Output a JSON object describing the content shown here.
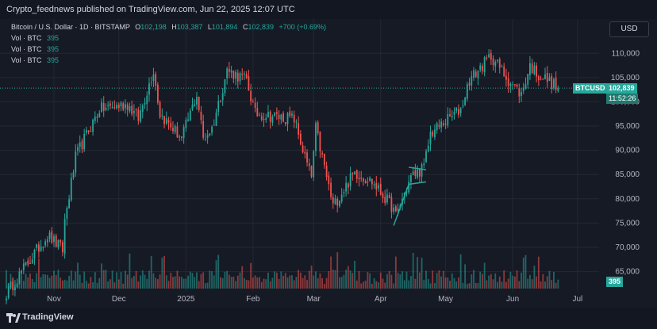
{
  "header": {
    "publisher": "Crypto_feednews published on TradingView.com, Jun 22, 2025 12:07 UTC"
  },
  "legend": {
    "title": "Bitcoin / U.S. Dollar · 1D · BITSTAMP",
    "o_label": "O",
    "o_val": "102,198",
    "h_label": "H",
    "h_val": "103,387",
    "l_label": "L",
    "l_val": "101,894",
    "c_label": "C",
    "c_val": "102,839",
    "change": "+700 (+0.69%)",
    "vol_lines": [
      {
        "label": "Vol · BTC",
        "value": "395"
      },
      {
        "label": "Vol · BTC",
        "value": "395"
      },
      {
        "label": "Vol · BTC",
        "value": "395"
      }
    ]
  },
  "currency_button": "USD",
  "price_tag": {
    "symbol": "BTCUSD",
    "price": "102,839",
    "countdown": "11:52:26"
  },
  "volume_tag": "395",
  "footer": {
    "brand": "TradingView"
  },
  "colors": {
    "up": "#26a69a",
    "down": "#ef5350",
    "background": "#131722",
    "grid": "#242833"
  },
  "chart_data": {
    "type": "candlestick",
    "title": "Bitcoin / U.S. Dollar · 1D · BITSTAMP",
    "y_ticks": [
      110000,
      105000,
      100000,
      95000,
      90000,
      85000,
      80000,
      75000,
      70000,
      65000
    ],
    "y_tick_labels": [
      "110,000",
      "105,000",
      "100,000",
      "95,000",
      "90,000",
      "85,000",
      "80,000",
      "75,000",
      "70,000",
      "65,000"
    ],
    "ylim": [
      61500,
      113800
    ],
    "x_tick_labels": [
      "Nov",
      "Dec",
      "2025",
      "Feb",
      "Mar",
      "Apr",
      "May",
      "Jun",
      "Jul"
    ],
    "x_tick_dates": [
      "2024-11-01",
      "2024-12-01",
      "2025-01-01",
      "2025-02-01",
      "2025-03-01",
      "2025-04-01",
      "2025-05-01",
      "2025-06-01",
      "2025-07-01"
    ],
    "start_date": "2024-10-10",
    "end_date": "2025-06-22",
    "anchor_closes": [
      [
        "2024-10-10",
        60500
      ],
      [
        "2024-10-21",
        67500
      ],
      [
        "2024-10-29",
        72500
      ],
      [
        "2024-11-05",
        69500
      ],
      [
        "2024-11-06",
        75500
      ],
      [
        "2024-11-11",
        88500
      ],
      [
        "2024-11-13",
        90500
      ],
      [
        "2024-11-22",
        98500
      ],
      [
        "2024-12-05",
        99500
      ],
      [
        "2024-12-10",
        96500
      ],
      [
        "2024-12-17",
        106500
      ],
      [
        "2024-12-20",
        97500
      ],
      [
        "2024-12-30",
        92500
      ],
      [
        "2025-01-06",
        101500
      ],
      [
        "2025-01-09",
        92500
      ],
      [
        "2025-01-13",
        94500
      ],
      [
        "2025-01-20",
        106500
      ],
      [
        "2025-01-29",
        104500
      ],
      [
        "2025-02-02",
        97500
      ],
      [
        "2025-02-20",
        96500
      ],
      [
        "2025-02-25",
        88500
      ],
      [
        "2025-02-28",
        84500
      ],
      [
        "2025-03-02",
        94500
      ],
      [
        "2025-03-10",
        78500
      ],
      [
        "2025-03-20",
        85500
      ],
      [
        "2025-03-28",
        83500
      ],
      [
        "2025-04-06",
        78500
      ],
      [
        "2025-04-08",
        76500
      ],
      [
        "2025-04-15",
        84500
      ],
      [
        "2025-04-21",
        86500
      ],
      [
        "2025-04-24",
        93500
      ],
      [
        "2025-05-08",
        98500
      ],
      [
        "2025-05-12",
        104500
      ],
      [
        "2025-05-22",
        109500
      ],
      [
        "2025-05-30",
        104500
      ],
      [
        "2025-06-05",
        101500
      ],
      [
        "2025-06-09",
        107500
      ],
      [
        "2025-06-13",
        105500
      ],
      [
        "2025-06-17",
        104500
      ],
      [
        "2025-06-22",
        102839
      ]
    ],
    "last_candle": {
      "date": "2025-06-22",
      "open": 102198,
      "high": 103387,
      "low": 101894,
      "close": 102839
    },
    "volume_last": 395,
    "annotations": [
      {
        "type": "line",
        "color": "#26a69a",
        "points": [
          [
            "2025-04-07",
            74500
          ],
          [
            "2025-04-14",
            83000
          ],
          [
            "2025-04-22",
            83500
          ]
        ]
      },
      {
        "type": "line",
        "color": "#26a69a",
        "points": [
          [
            "2025-04-14",
            86500
          ],
          [
            "2025-04-22",
            86000
          ]
        ]
      }
    ],
    "grid": true
  }
}
